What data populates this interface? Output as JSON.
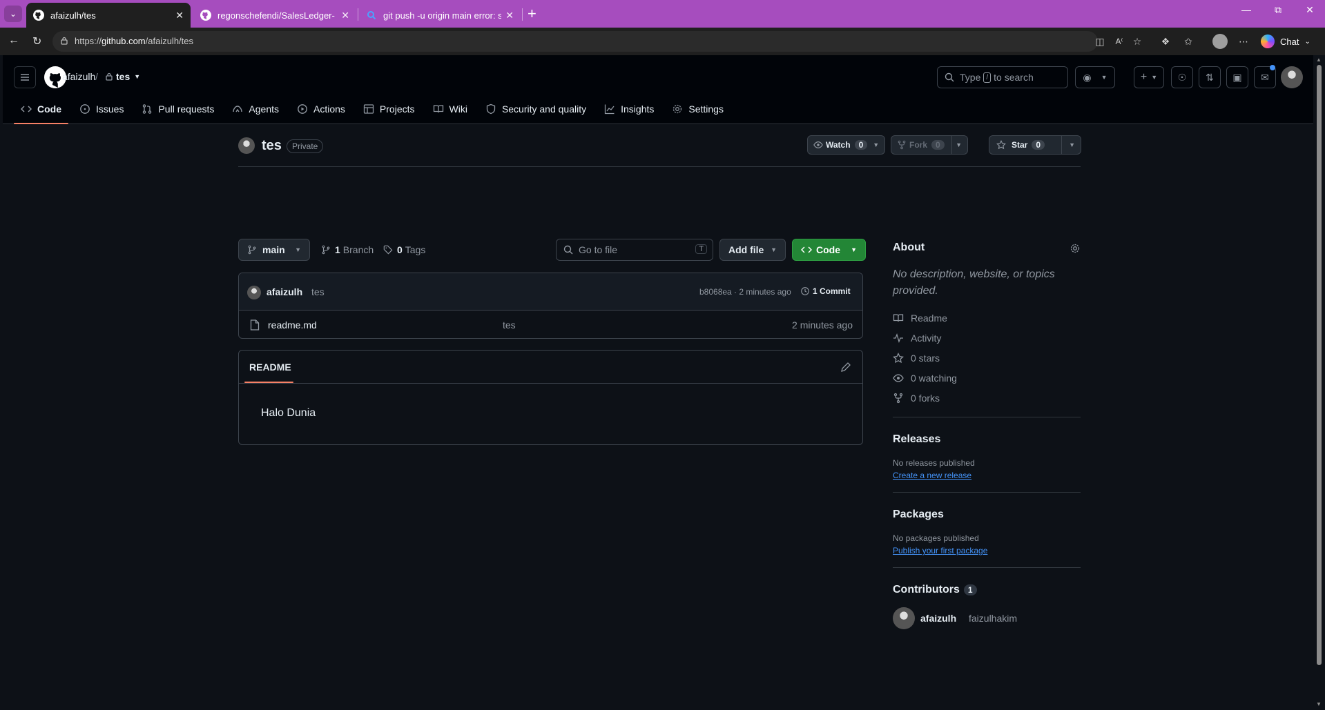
{
  "browser": {
    "tabs": [
      {
        "title": "afaizulh/tes",
        "active": true
      },
      {
        "title": "regonschefendi/SalesLedger-",
        "active": false
      },
      {
        "title": "git push -u origin main error: src r",
        "active": false
      }
    ],
    "url_prefix": "https://",
    "url_host": "github.com",
    "url_path": "/afaizulh/tes",
    "chat_label": "Chat"
  },
  "header": {
    "owner": "afaizulh",
    "separator": "/",
    "repo": "tes",
    "search_pre": "Type",
    "search_key": "/",
    "search_post": "to search"
  },
  "repo_nav": [
    {
      "label": "Code",
      "icon": "code-icon"
    },
    {
      "label": "Issues",
      "icon": "issue-icon"
    },
    {
      "label": "Pull requests",
      "icon": "pull-request-icon"
    },
    {
      "label": "Agents",
      "icon": "agent-icon"
    },
    {
      "label": "Actions",
      "icon": "play-icon"
    },
    {
      "label": "Projects",
      "icon": "table-icon"
    },
    {
      "label": "Wiki",
      "icon": "book-icon"
    },
    {
      "label": "Security and quality",
      "icon": "shield-icon"
    },
    {
      "label": "Insights",
      "icon": "graph-icon"
    },
    {
      "label": "Settings",
      "icon": "gear-icon"
    }
  ],
  "repo": {
    "name": "tes",
    "visibility": "Private",
    "watch_label": "Watch",
    "watch_count": "0",
    "fork_label": "Fork",
    "fork_count": "0",
    "star_label": "Star",
    "star_count": "0"
  },
  "toolbar": {
    "branch": "main",
    "branch_count": "1",
    "branch_label": "Branch",
    "tag_count": "0",
    "tag_label": "Tags",
    "goto_placeholder": "Go to file",
    "goto_key": "T",
    "add_file": "Add file",
    "code": "Code"
  },
  "commit": {
    "author": "afaizulh",
    "message": "tes",
    "meta": "b8068ea · 2 minutes ago",
    "count": "1 Commit"
  },
  "files": [
    {
      "name": "readme.md",
      "commit": "tes",
      "age": "2 minutes ago"
    }
  ],
  "readme": {
    "tab": "README",
    "content": "Halo Dunia"
  },
  "sidebar": {
    "about_title": "About",
    "description": "No description, website, or topics provided.",
    "links": [
      {
        "label": "Readme",
        "icon": "book-icon"
      },
      {
        "label": "Activity",
        "icon": "pulse-icon"
      },
      {
        "label": "0 stars",
        "icon": "star-icon"
      },
      {
        "label": "0 watching",
        "icon": "eye-icon"
      },
      {
        "label": "0 forks",
        "icon": "fork-icon"
      }
    ],
    "releases_title": "Releases",
    "releases_text": "No releases published",
    "releases_link": "Create a new release",
    "packages_title": "Packages",
    "packages_text": "No packages published",
    "packages_link": "Publish your first package",
    "contributors_title": "Contributors",
    "contributors_count": "1",
    "contributor_name": "afaizulh",
    "contributor_handle": "faizulhakim"
  },
  "colors": {
    "tabbar": "#a64dbe",
    "page_bg": "#0d1117",
    "accent_underline": "#f78166",
    "code_button": "#238636",
    "link": "#4493f8"
  }
}
